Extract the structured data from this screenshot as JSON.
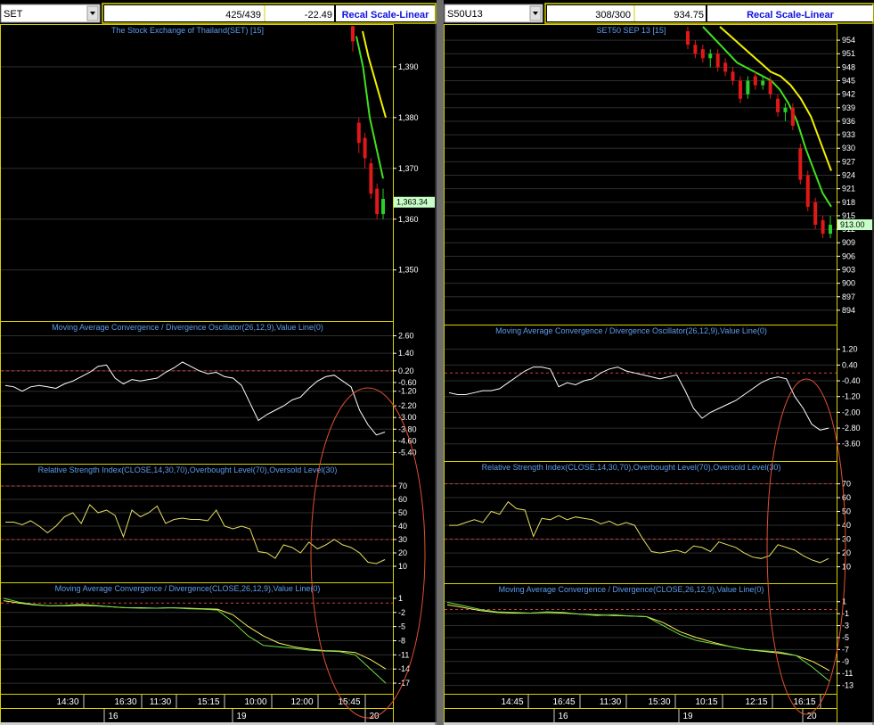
{
  "panels": [
    {
      "id": "left",
      "symbol": "SET",
      "count": "425/439",
      "change": "-22.49",
      "recal_label": "Recal Scale-Linear",
      "price": {
        "title": "The Stock Exchange of Thailand(SET) [15]",
        "ylim": [
          1341,
          1397
        ],
        "ticks": [
          "1,390",
          "1,380",
          "1,370",
          "1,360",
          "1,350"
        ],
        "tick_values": [
          1390,
          1380,
          1370,
          1360,
          1350
        ],
        "last_value": 1363.34,
        "last_label": "1,363.34",
        "candles": [
          {
            "o": 1398,
            "h": 1399,
            "l": 1393,
            "c": 1395,
            "dir": "down"
          },
          {
            "o": 1379,
            "h": 1380,
            "l": 1373,
            "c": 1375,
            "dir": "down"
          },
          {
            "o": 1376,
            "h": 1377,
            "l": 1370,
            "c": 1372,
            "dir": "down"
          },
          {
            "o": 1371,
            "h": 1372,
            "l": 1364,
            "c": 1365,
            "dir": "down"
          },
          {
            "o": 1366,
            "h": 1367,
            "l": 1360,
            "c": 1361,
            "dir": "down"
          },
          {
            "o": 1361,
            "h": 1366,
            "l": 1360,
            "c": 1364,
            "dir": "up"
          }
        ],
        "ma_green": [
          1396,
          1390,
          1380,
          1374,
          1368
        ],
        "ma_yellow": [
          1397,
          1392,
          1388,
          1384,
          1380
        ]
      },
      "macd_osc": {
        "title": "Moving Average Convergence / Divergence Oscillator(26,12,9),Value Line(0)",
        "ticks": [
          "2.60",
          "1.40",
          "0.20",
          "-0.60",
          "-1.20",
          "-2.20",
          "-3.00",
          "-3.80",
          "-4.60",
          "-5.40"
        ],
        "ylim": [
          -5.8,
          3.0
        ],
        "ref": 0.2,
        "values": [
          -0.8,
          -0.9,
          -1.2,
          -0.9,
          -0.8,
          -0.9,
          -1.0,
          -0.7,
          -0.5,
          -0.2,
          0.1,
          0.5,
          0.6,
          -0.3,
          -0.7,
          -0.4,
          -0.5,
          -0.4,
          -0.3,
          0.1,
          0.4,
          0.8,
          0.5,
          0.2,
          0.0,
          0.1,
          -0.2,
          -0.3,
          -0.8,
          -2.0,
          -3.2,
          -2.8,
          -2.5,
          -2.2,
          -1.8,
          -1.6,
          -1.0,
          -0.5,
          -0.2,
          -0.1,
          -0.5,
          -0.9,
          -2.5,
          -3.5,
          -4.2,
          -4.0
        ]
      },
      "rsi": {
        "title": "Relative Strength Index(CLOSE,14,30,70),Overbought Level(70),Oversold Level(30)",
        "ticks": [
          "70",
          "60",
          "50",
          "40",
          "30",
          "20",
          "10"
        ],
        "tick_values": [
          70,
          60,
          50,
          40,
          30,
          20,
          10
        ],
        "ylim": [
          2,
          80
        ],
        "overbought": 70,
        "oversold": 30,
        "values": [
          43,
          43,
          41,
          44,
          40,
          35,
          40,
          47,
          50,
          42,
          56,
          50,
          52,
          48,
          32,
          52,
          47,
          50,
          55,
          42,
          45,
          46,
          45,
          45,
          44,
          52,
          40,
          38,
          40,
          38,
          21,
          20,
          16,
          26,
          24,
          20,
          28,
          23,
          26,
          30,
          26,
          24,
          20,
          13,
          12,
          15
        ]
      },
      "macd": {
        "title": "Moving Average Convergence / Divergence(CLOSE,26,12,9),Value Line(0)",
        "ticks": [
          "1",
          "-2",
          "-5",
          "-8",
          "-11",
          "-14",
          "-17"
        ],
        "tick_values": [
          1,
          -2,
          -5,
          -8,
          -11,
          -14,
          -17
        ],
        "ylim": [
          -18.5,
          2.5
        ],
        "ref": 0,
        "line_green": [
          1,
          0.2,
          -0.3,
          -0.6,
          -0.5,
          -0.3,
          -0.5,
          -0.8,
          -1.0,
          -1.1,
          -1.1,
          -1.0,
          -1.2,
          -1.3,
          -1.5,
          -4,
          -7,
          -9,
          -9.3,
          -9.6,
          -10,
          -10.2,
          -10.3,
          -11,
          -14,
          -17
        ],
        "line_yellow": [
          0.5,
          0,
          -0.4,
          -0.6,
          -0.6,
          -0.5,
          -0.6,
          -0.8,
          -1.0,
          -1.0,
          -1.1,
          -1.0,
          -1.1,
          -1.2,
          -1.3,
          -2.5,
          -5,
          -7,
          -8.5,
          -9.3,
          -9.8,
          -10.1,
          -10.2,
          -10.5,
          -12,
          -14
        ]
      },
      "times": [
        "14:30",
        "16:30",
        "11:30",
        "15:15",
        "10:00",
        "12:00",
        "15:45"
      ],
      "days": [
        "16",
        "19",
        "20"
      ]
    },
    {
      "id": "right",
      "symbol": "S50U13",
      "count": "308/300",
      "change": "934.75",
      "recal_label": "Recal Scale-Linear",
      "price": {
        "title": "SET50 SEP 13   [15]",
        "ylim": [
          892,
          956
        ],
        "ticks": [
          "954",
          "951",
          "948",
          "945",
          "942",
          "939",
          "936",
          "933",
          "930",
          "927",
          "924",
          "921",
          "918",
          "915",
          "912",
          "909",
          "906",
          "903",
          "900",
          "897",
          "894"
        ],
        "tick_values": [
          954,
          951,
          948,
          945,
          942,
          939,
          936,
          933,
          930,
          927,
          924,
          921,
          918,
          915,
          912,
          909,
          906,
          903,
          900,
          897,
          894
        ],
        "last_value": 913.0,
        "last_label": "913.00",
        "candles": [
          {
            "o": 956,
            "h": 957,
            "l": 952,
            "c": 953,
            "dir": "down"
          },
          {
            "o": 953,
            "h": 954,
            "l": 950,
            "c": 951,
            "dir": "down"
          },
          {
            "o": 952,
            "h": 953,
            "l": 949,
            "c": 950,
            "dir": "down"
          },
          {
            "o": 950,
            "h": 952,
            "l": 948,
            "c": 951,
            "dir": "up"
          },
          {
            "o": 951,
            "h": 952,
            "l": 947,
            "c": 948,
            "dir": "down"
          },
          {
            "o": 949,
            "h": 950,
            "l": 946,
            "c": 947,
            "dir": "down"
          },
          {
            "o": 947,
            "h": 948,
            "l": 944,
            "c": 945,
            "dir": "down"
          },
          {
            "o": 945,
            "h": 946,
            "l": 940,
            "c": 941,
            "dir": "down"
          },
          {
            "o": 942,
            "h": 946,
            "l": 941,
            "c": 945,
            "dir": "up"
          },
          {
            "o": 946,
            "h": 947,
            "l": 943,
            "c": 944,
            "dir": "down"
          },
          {
            "o": 944,
            "h": 946,
            "l": 943,
            "c": 945,
            "dir": "up"
          },
          {
            "o": 945,
            "h": 946,
            "l": 941,
            "c": 942,
            "dir": "down"
          },
          {
            "o": 941,
            "h": 942,
            "l": 937,
            "c": 938,
            "dir": "down"
          },
          {
            "o": 938,
            "h": 940,
            "l": 936,
            "c": 939,
            "dir": "up"
          },
          {
            "o": 939,
            "h": 940,
            "l": 934,
            "c": 935,
            "dir": "down"
          },
          {
            "o": 930,
            "h": 931,
            "l": 922,
            "c": 923,
            "dir": "down"
          },
          {
            "o": 924,
            "h": 925,
            "l": 916,
            "c": 917,
            "dir": "down"
          },
          {
            "o": 918,
            "h": 919,
            "l": 912,
            "c": 913,
            "dir": "down"
          },
          {
            "o": 914,
            "h": 915,
            "l": 910,
            "c": 911,
            "dir": "down"
          },
          {
            "o": 911,
            "h": 915,
            "l": 910,
            "c": 913,
            "dir": "up"
          }
        ],
        "ma_green": [
          957,
          955,
          953,
          951,
          949,
          948,
          947,
          946,
          945,
          943,
          940,
          936,
          930,
          925,
          920,
          917
        ],
        "ma_yellow": [
          957,
          955,
          953,
          951,
          949,
          947,
          946,
          944,
          941,
          937,
          931,
          925
        ]
      },
      "macd_osc": {
        "title": "Moving Average Convergence / Divergence Oscillator(26,12,9),Value Line(0)",
        "ticks": [
          "1.20",
          "0.40",
          "-0.40",
          "-1.20",
          "-2.00",
          "-2.80",
          "-3.60"
        ],
        "tick_values": [
          1.2,
          0.4,
          -0.4,
          -1.2,
          -2.0,
          -2.8,
          -3.6
        ],
        "ylim": [
          -4.2,
          2.0
        ],
        "ref": 0,
        "values": [
          -1.0,
          -1.1,
          -1.1,
          -1.0,
          -0.9,
          -0.9,
          -0.8,
          -0.5,
          -0.2,
          0.1,
          0.3,
          0.3,
          0.2,
          -0.7,
          -0.5,
          -0.6,
          -0.4,
          -0.3,
          0.0,
          0.2,
          0.3,
          0.1,
          0.0,
          -0.1,
          -0.2,
          -0.3,
          -0.2,
          -0.1,
          -0.9,
          -1.8,
          -2.3,
          -2.0,
          -1.8,
          -1.6,
          -1.4,
          -1.1,
          -0.8,
          -0.5,
          -0.3,
          -0.2,
          -0.3,
          -1.2,
          -1.8,
          -2.6,
          -2.9,
          -2.8
        ]
      },
      "rsi": {
        "title": "Relative Strength Index(CLOSE,14,30,70),Overbought Level(70),Oversold Level(30)",
        "ticks": [
          "70",
          "60",
          "50",
          "40",
          "30",
          "20",
          "10"
        ],
        "tick_values": [
          70,
          60,
          50,
          40,
          30,
          20,
          10
        ],
        "ylim": [
          2,
          80
        ],
        "overbought": 70,
        "oversold": 30,
        "values": [
          40,
          40,
          42,
          44,
          42,
          50,
          48,
          57,
          52,
          51,
          32,
          45,
          44,
          47,
          44,
          46,
          45,
          44,
          41,
          43,
          40,
          42,
          40,
          30,
          21,
          20,
          21,
          22,
          20,
          25,
          24,
          21,
          28,
          26,
          24,
          20,
          17,
          16,
          18,
          26,
          24,
          22,
          18,
          15,
          13,
          16
        ]
      },
      "macd": {
        "title": "Moving Average Convergence / Divergence(CLOSE,26,12,9),Value Line(0)",
        "ticks": [
          "1",
          "-1",
          "-3",
          "-5",
          "-7",
          "-9",
          "-11",
          "-13"
        ],
        "tick_values": [
          1,
          -1,
          -3,
          -5,
          -7,
          -9,
          -11,
          -13
        ],
        "ylim": [
          -13.8,
          2.6
        ],
        "ref": -0.3,
        "line_green": [
          0.9,
          0.3,
          -0.3,
          -0.7,
          -0.8,
          -0.9,
          -0.7,
          -0.8,
          -1.1,
          -1.3,
          -1.2,
          -1.4,
          -1.5,
          -3,
          -4.5,
          -5.5,
          -6,
          -6.5,
          -7,
          -7.2,
          -7.4,
          -8,
          -10,
          -12.3
        ],
        "line_yellow": [
          0.5,
          0,
          -0.5,
          -0.8,
          -0.9,
          -0.9,
          -0.8,
          -0.9,
          -1.1,
          -1.2,
          -1.3,
          -1.4,
          -1.5,
          -2.5,
          -4,
          -5,
          -5.8,
          -6.5,
          -7,
          -7.3,
          -7.6,
          -8,
          -9,
          -10.5
        ]
      },
      "times": [
        "14:45",
        "16:45",
        "11:30",
        "15:30",
        "10:15",
        "12:15",
        "16:15"
      ],
      "days": [
        "16",
        "19",
        "20"
      ]
    }
  ],
  "colors": {
    "background": "#000000",
    "frame": "#d8d000",
    "title": "#5c9df0",
    "axis_text": "#ffffff",
    "grid": "#2e2e2e",
    "ref_line": "#d04040",
    "candle_down": "#e01818",
    "candle_up": "#28d028",
    "ma_green": "#40e020",
    "ma_yellow": "#f0f000",
    "osc_line": "#ffffff",
    "rsi_line": "#e8e060",
    "macd_green": "#70e040",
    "macd_yellow": "#f8f060",
    "ellipse": "#e05030",
    "recal_text": "#1010e0",
    "last_label_bg": "#c8ffc8"
  }
}
